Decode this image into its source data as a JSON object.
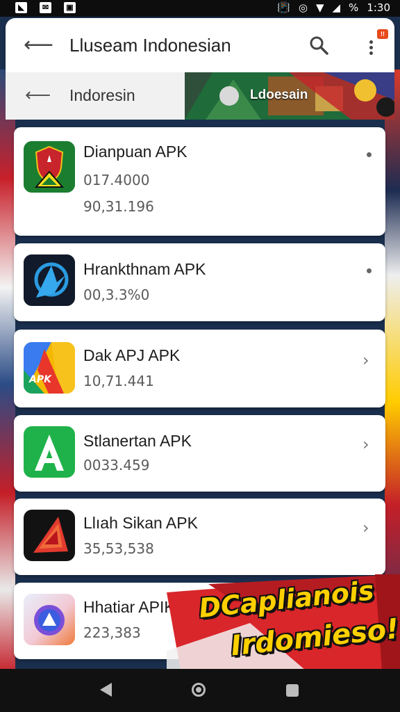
{
  "status_bar": {
    "time": "1:30",
    "battery": "%"
  },
  "app_bar": {
    "title": "Lluseam Indonesian",
    "notification_badge": "!!"
  },
  "sub_bar": {
    "title": "Indoresin",
    "banner_text": "Ldoesain"
  },
  "apps": [
    {
      "name": "Dianpuan APK",
      "meta1": "017.4000",
      "meta2": "90,31.196",
      "action": "kebab-icon"
    },
    {
      "name": "Hrankthnam APK",
      "meta1": "00,3.3%0",
      "action": "kebab-icon"
    },
    {
      "name": "Dak APJ APK",
      "meta1": "10,71.441",
      "action": "chevron-right-icon"
    },
    {
      "name": "Stlanertan APK",
      "meta1": "0033.459",
      "action": "chevron-right-icon"
    },
    {
      "name": "Llıah Sikan APK",
      "meta1": "35,53,538",
      "action": "chevron-right-icon"
    },
    {
      "name": "Hhatiar APIK",
      "meta1": "223,383",
      "action": "none"
    }
  ],
  "promo": {
    "line1": "DCaplianois",
    "line2": "Irdomieso!"
  },
  "colors": {
    "accent_red": "#d9262a",
    "promo_yellow": "#ffd000",
    "nav_bar": "#111111"
  }
}
